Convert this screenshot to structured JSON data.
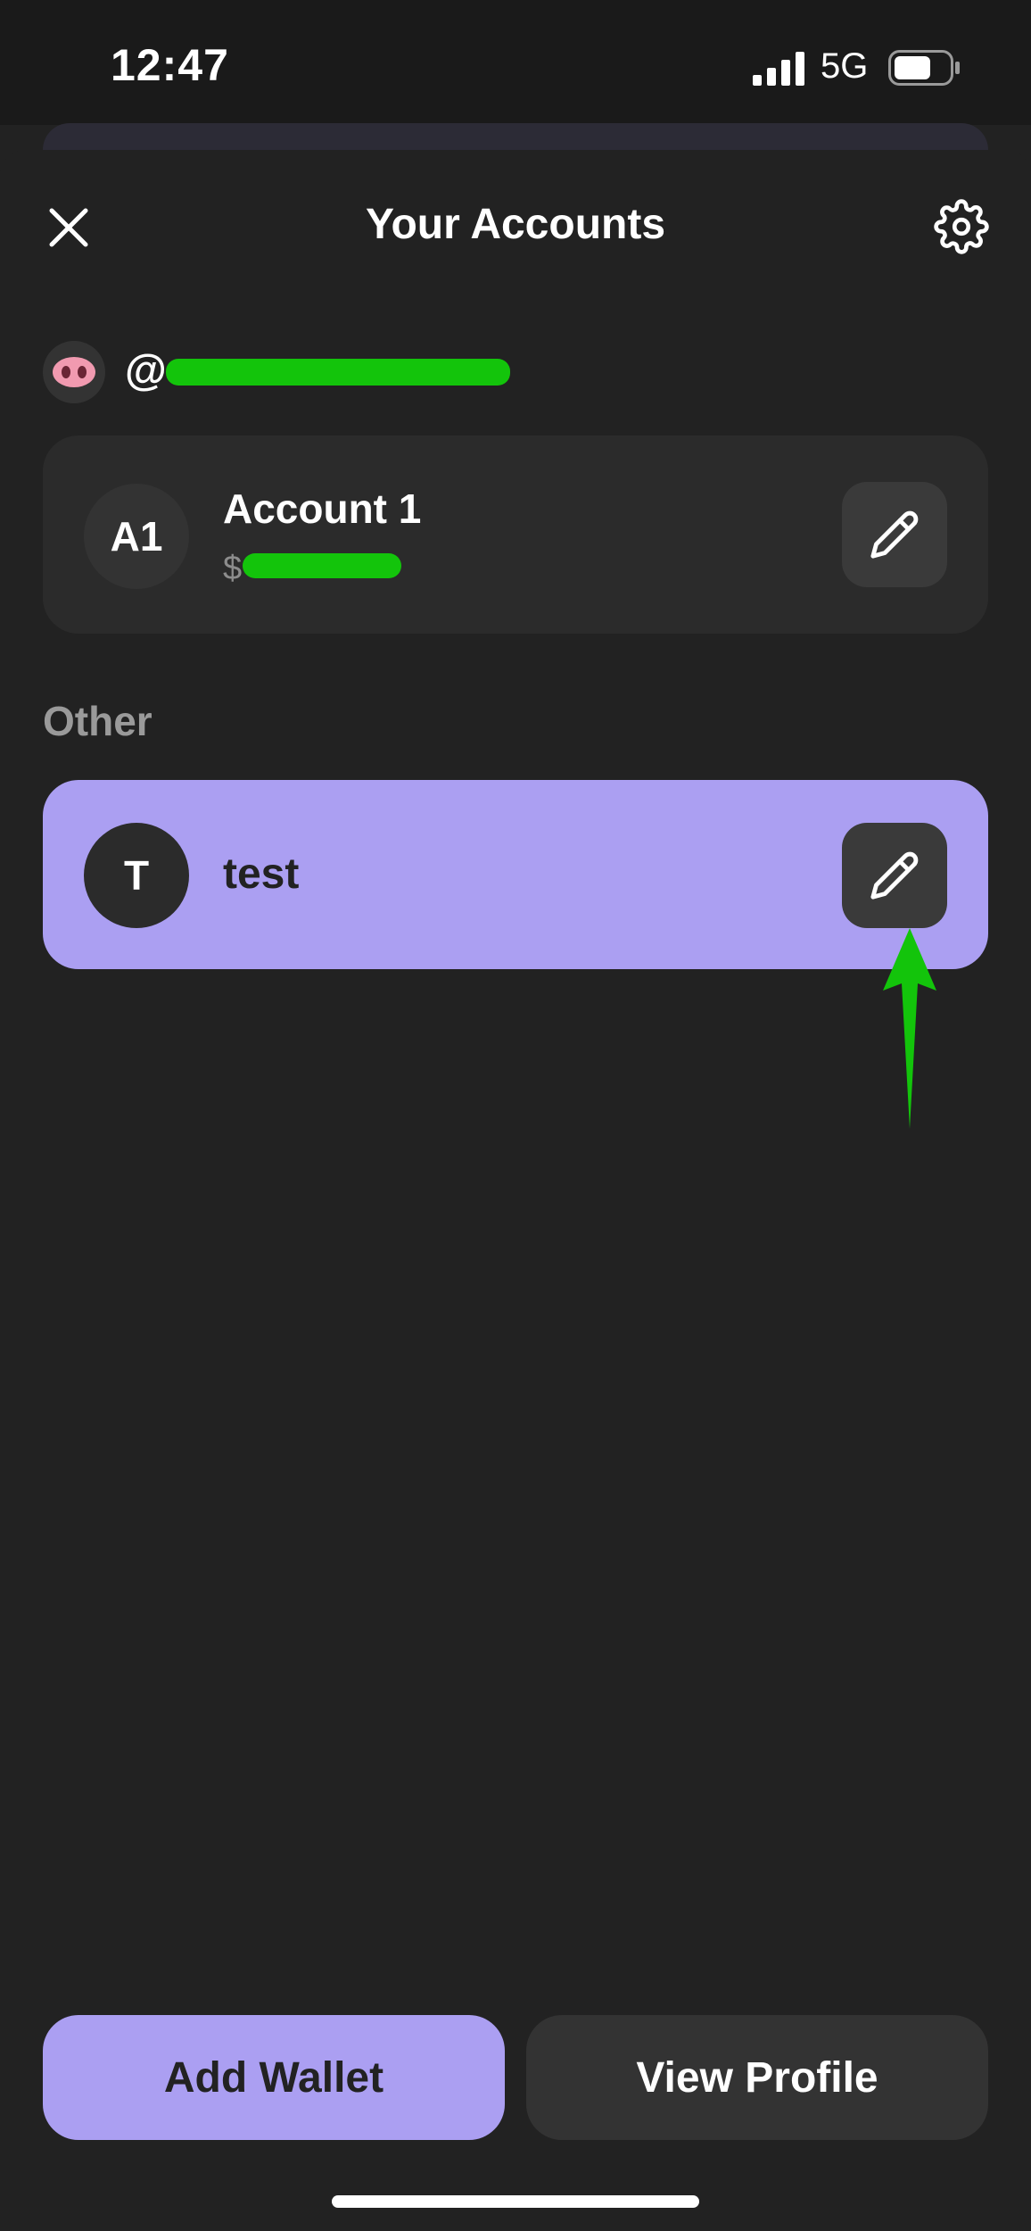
{
  "status_bar": {
    "time": "12:47",
    "network": "5G",
    "icons": [
      "signal-icon",
      "battery-icon"
    ]
  },
  "header": {
    "title": "Your Accounts",
    "close_icon": "close-icon",
    "settings_icon": "gear-icon"
  },
  "profile": {
    "avatar_emoji": "🐽",
    "username": "@"
  },
  "accounts": [
    {
      "initials": "A1",
      "name": "Account 1",
      "balance": "$",
      "edit_icon": "pencil-icon"
    }
  ],
  "other": {
    "heading": "Other",
    "wallets": [
      {
        "initial": "T",
        "name": "test",
        "edit_icon": "pencil-icon"
      }
    ]
  },
  "actions": {
    "add_wallet": "Add Wallet",
    "view_profile": "View Profile"
  },
  "colors": {
    "accent": "#ab9ff2",
    "background": "#222222",
    "card": "#2b2b2b",
    "annotation": "#13c40b"
  }
}
